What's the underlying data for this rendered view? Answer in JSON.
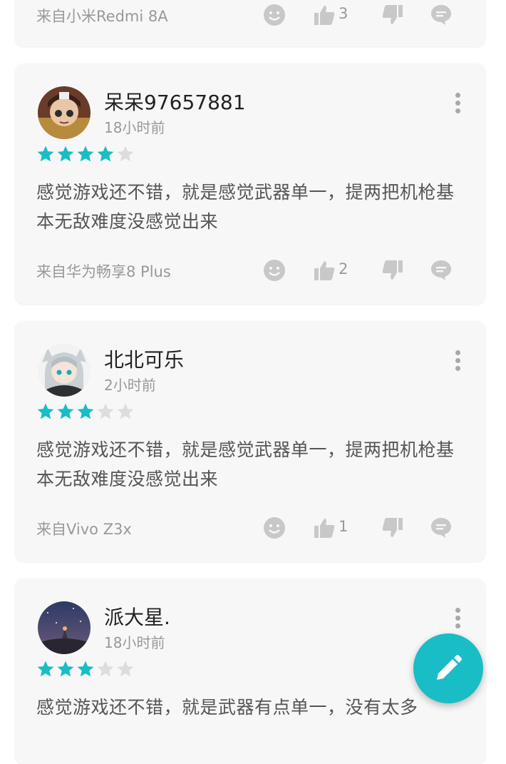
{
  "reviews": [
    {
      "user": "",
      "time": "",
      "rating": 0,
      "text": "",
      "device": "来自小米Redmi 8A",
      "likes": "3"
    },
    {
      "user": "呆呆97657881",
      "time": "18小时前",
      "rating": 4,
      "text": "感觉游戏还不错，就是感觉武器单一，提两把机枪基本无敌难度没感觉出来",
      "device": "来自华为畅享8 Plus",
      "likes": "2"
    },
    {
      "user": "北北可乐",
      "time": "2小时前",
      "rating": 3,
      "text": "感觉游戏还不错，就是感觉武器单一，提两把机枪基本无敌难度没感觉出来",
      "device": "来自Vivo Z3x",
      "likes": "1"
    },
    {
      "user": "派大星.",
      "time": "18小时前",
      "rating": 3,
      "text": "感觉游戏还不错，就是武器有点单一，没有太多",
      "device": "",
      "likes": ""
    }
  ],
  "icons": {
    "smile": "smile-icon",
    "like": "thumbs-up-icon",
    "dislike": "thumbs-down-icon",
    "comment": "comment-icon",
    "more": "more-vertical-icon",
    "fab": "pencil-icon"
  },
  "colors": {
    "accent": "#19bdc6",
    "star_on": "#19bdc6",
    "star_off": "#dddddd",
    "card_bg": "#f7f7f7",
    "icon_gray": "#c4c4c4"
  }
}
